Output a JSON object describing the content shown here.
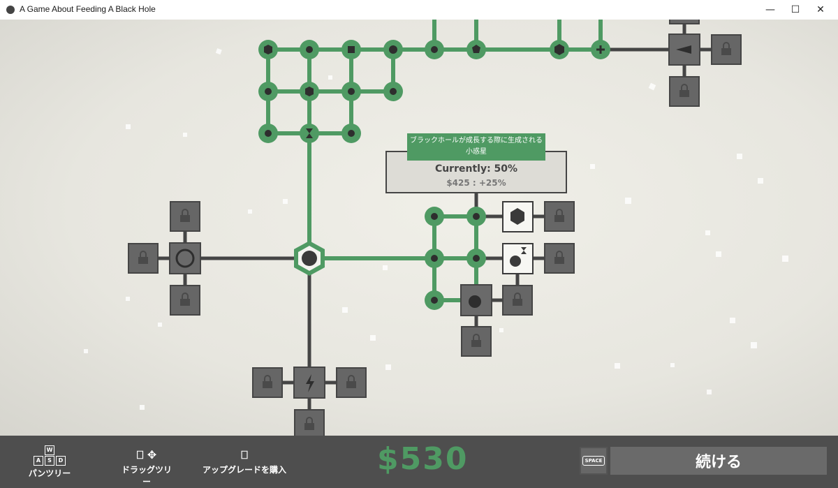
{
  "window": {
    "title": "A Game About Feeding A Black Hole",
    "minimize": "—",
    "maximize": "☐",
    "close": "✕"
  },
  "tooltip": {
    "description_line1": "ブラックホールが成長する際に生成される",
    "description_line2": "小惑星",
    "currently": "Currently: 50%",
    "price": "$425 : +25%"
  },
  "controls": {
    "pan_label": "パンツリー",
    "keys": [
      "W",
      "A",
      "S",
      "D"
    ],
    "drag_label": "ドラッグツリー",
    "buy_label": "アップグレードを購入"
  },
  "money": "$530",
  "space_key": "SPACE",
  "continue_label": "続ける",
  "colors": {
    "owned": "#4f9a63",
    "locked": "#666666",
    "path": "#454545",
    "bar": "#4e4e4e"
  }
}
